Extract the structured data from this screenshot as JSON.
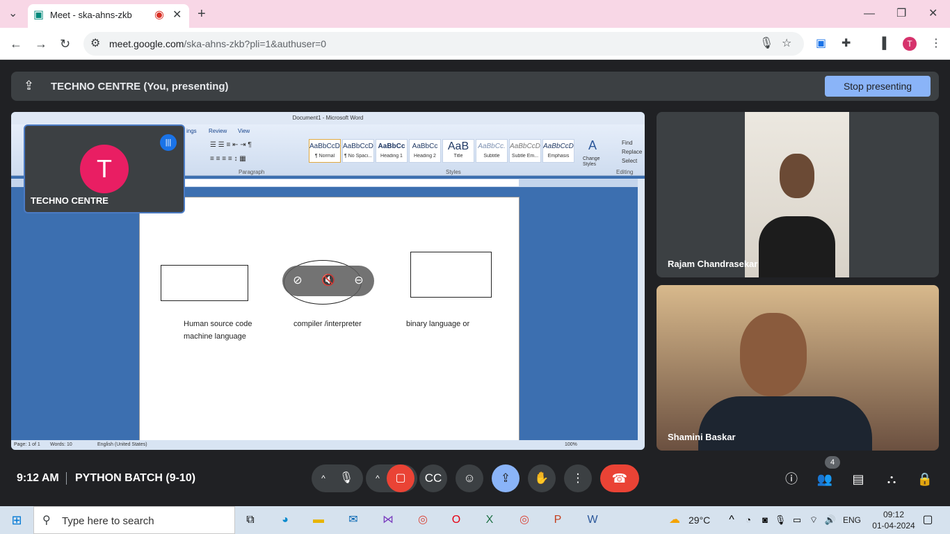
{
  "browser": {
    "tab_title": "Meet - ska-ahns-zkb",
    "url_host": "meet.google.com",
    "url_path": "/ska-ahns-zkb?pli=1&authuser=0",
    "profile_letter": "T"
  },
  "banner": {
    "label": "TECHNO CENTRE (You, presenting)",
    "stop_label": "Stop presenting"
  },
  "word": {
    "title": "Document1 - Microsoft Word",
    "tabs": [
      "ings",
      "Review",
      "View"
    ],
    "groups": {
      "paragraph": "Paragraph",
      "styles": "Styles",
      "editing": "Editing"
    },
    "styles": [
      {
        "sample": "AaBbCcDc",
        "name": "¶ Normal"
      },
      {
        "sample": "AaBbCcDc",
        "name": "¶ No Spaci..."
      },
      {
        "sample": "AaBbCc",
        "name": "Heading 1"
      },
      {
        "sample": "AaBbCc",
        "name": "Heading 2"
      },
      {
        "sample": "AaB",
        "name": "Title"
      },
      {
        "sample": "AaBbCc.",
        "name": "Subtitle"
      },
      {
        "sample": "AaBbCcDc",
        "name": "Subtle Em..."
      },
      {
        "sample": "AaBbCcDc",
        "name": "Emphasis"
      }
    ],
    "change_styles": "Change Styles",
    "editing": {
      "find": "Find",
      "replace": "Replace",
      "select": "Select"
    },
    "doc_texts": {
      "left": "Human source code machine language",
      "middle": "compiler /interpreter",
      "right": "binary language or"
    },
    "status": {
      "page": "Page: 1 of 1",
      "words": "Words: 10",
      "language": "English (United States)",
      "zoom": "100%"
    }
  },
  "self_tile": {
    "initial": "T",
    "name": "TECHNO CENTRE"
  },
  "participants": [
    {
      "name": "Rajam Chandrasekar"
    },
    {
      "name": "Shamini Baskar"
    }
  ],
  "meet_bar": {
    "time": "9:12 AM",
    "meeting_name": "PYTHON BATCH (9-10)",
    "people_count": "4"
  },
  "taskbar": {
    "search_placeholder": "Type here to search",
    "temperature": "29°C",
    "language": "ENG",
    "time": "09:12",
    "date": "01-04-2024"
  },
  "colors": {
    "meet_bg": "#202124",
    "stop_button": "#8ab4f8",
    "end_call": "#ea4335",
    "camera_off": "#ea4335",
    "present_active": "#8ab4f8",
    "avatar": "#e91e63"
  }
}
